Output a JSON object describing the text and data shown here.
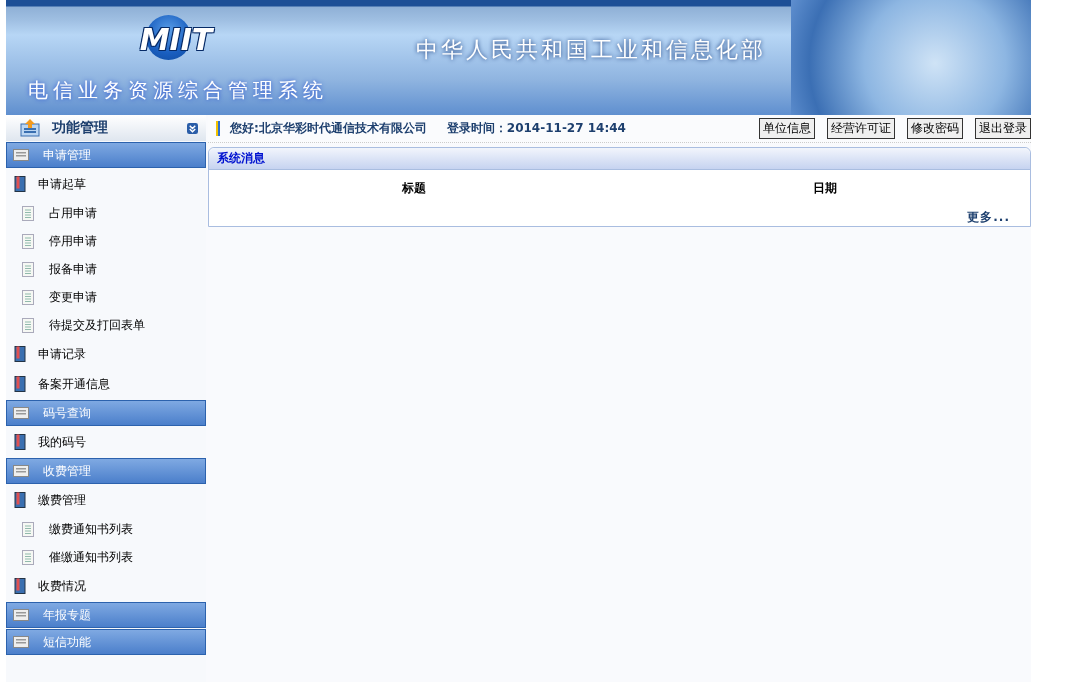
{
  "banner": {
    "logo": "MIIT",
    "ministry": "中华人民共和国工业和信息化部",
    "system": "电信业务资源综合管理系统"
  },
  "sidebar": {
    "title": "功能管理",
    "groups": [
      {
        "label": "申请管理",
        "items": [
          {
            "label": "申请起草",
            "children": [
              {
                "label": "占用申请"
              },
              {
                "label": "停用申请"
              },
              {
                "label": "报备申请"
              },
              {
                "label": "变更申请"
              },
              {
                "label": "待提交及打回表单"
              }
            ]
          },
          {
            "label": "申请记录"
          },
          {
            "label": "备案开通信息"
          }
        ]
      },
      {
        "label": "码号查询",
        "items": [
          {
            "label": "我的码号"
          }
        ]
      },
      {
        "label": "收费管理",
        "items": [
          {
            "label": "缴费管理",
            "children": [
              {
                "label": "缴费通知书列表"
              },
              {
                "label": "催缴通知书列表"
              }
            ]
          },
          {
            "label": "收费情况"
          }
        ]
      },
      {
        "label": "年报专题"
      },
      {
        "label": "短信功能"
      }
    ]
  },
  "topbar": {
    "greeting": "您好:北京华彩时代通信技术有限公司",
    "login_time": "登录时间：2014-11-27  14:44",
    "buttons": [
      "单位信息",
      "经营许可证",
      "修改密码",
      "退出登录"
    ]
  },
  "messages": {
    "title": "系统消息",
    "columns": [
      "标题",
      "日期"
    ],
    "more": "更多..."
  }
}
